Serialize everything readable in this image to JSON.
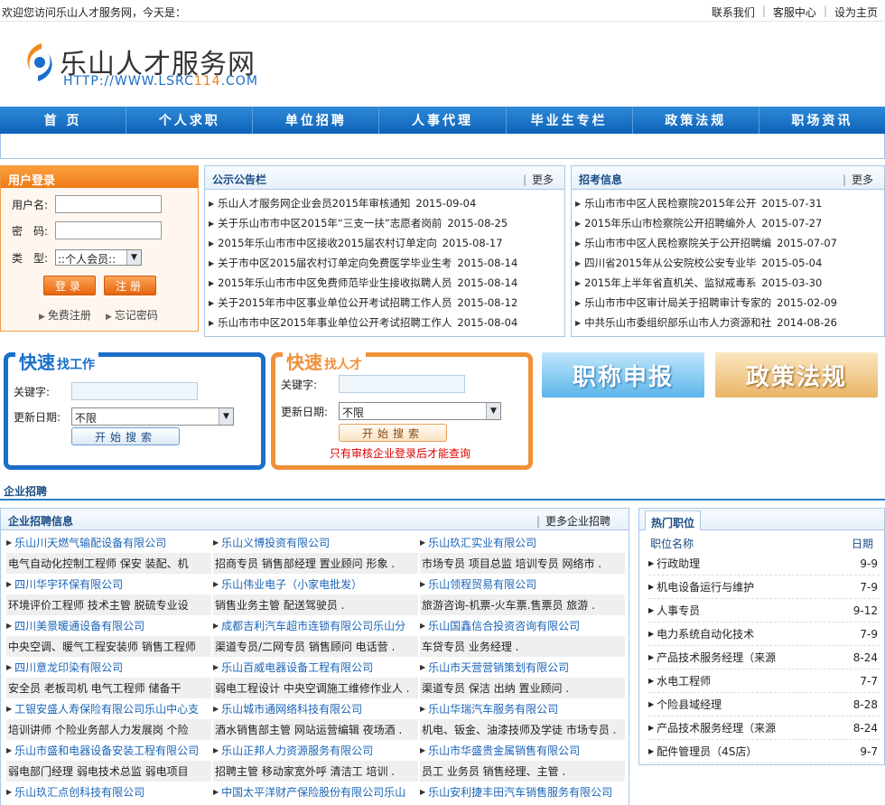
{
  "topbar": {
    "welcome": "欢迎您访问乐山人才服务网，今天是：",
    "links": [
      "联系我们",
      "客服中心",
      "设为主页"
    ]
  },
  "logo": {
    "name": "乐山人才服务网",
    "url_prefix": "HTTP://WWW.LSRC",
    "url_num": "114",
    "url_suffix": ".COM"
  },
  "nav": [
    "首 页",
    "个人求职",
    "单位招聘",
    "人事代理",
    "毕业生专栏",
    "政策法规",
    "职场资讯"
  ],
  "login": {
    "title": "用户登录",
    "username_label": "用户名:",
    "password_label": "密　码:",
    "type_label": "类　型:",
    "type_value": "::个人会员::",
    "login_btn": "登录",
    "register_btn": "注册",
    "free_register": "免费注册",
    "forgot_password": "忘记密码"
  },
  "notices": {
    "title": "公示公告栏",
    "more": "更多",
    "items": [
      {
        "title": "乐山人才服务网企业会员2015年审核通知",
        "date": "2015-09-04"
      },
      {
        "title": "关于乐山市市中区2015年“三支一扶”志愿者岗前",
        "date": "2015-08-25"
      },
      {
        "title": "2015年乐山市市中区接收2015届农村订单定向",
        "date": "2015-08-17"
      },
      {
        "title": "关于市中区2015届农村订单定向免费医学毕业生考",
        "date": "2015-08-14"
      },
      {
        "title": "2015年乐山市市中区免费师范毕业生接收拟聘人员",
        "date": "2015-08-14"
      },
      {
        "title": "关于2015年市中区事业单位公开考试招聘工作人员",
        "date": "2015-08-12"
      },
      {
        "title": "乐山市市中区2015年事业单位公开考试招聘工作人",
        "date": "2015-08-04"
      }
    ]
  },
  "recruit_info": {
    "title": "招考信息",
    "more": "更多",
    "items": [
      {
        "title": "乐山市市中区人民检察院2015年公开",
        "date": "2015-07-31"
      },
      {
        "title": "2015年乐山市检察院公开招聘编外人",
        "date": "2015-07-27"
      },
      {
        "title": "乐山市市中区人民检察院关于公开招聘编",
        "date": "2015-07-07"
      },
      {
        "title": "四川省2015年从公安院校公安专业毕",
        "date": "2015-05-04"
      },
      {
        "title": "2015年上半年省直机关、监狱戒毒系",
        "date": "2015-03-30"
      },
      {
        "title": "乐山市市中区审计局关于招聘审计专家的",
        "date": "2015-02-09"
      },
      {
        "title": "中共乐山市委组织部乐山市人力资源和社",
        "date": "2014-08-26"
      }
    ]
  },
  "quick_job": {
    "title_big": "快速",
    "title_small": "找工作",
    "keyword_label": "关键字:",
    "date_label": "更新日期:",
    "date_value": "不限",
    "search_btn": "开始搜索"
  },
  "quick_talent": {
    "title_big": "快速",
    "title_small": "找人才",
    "keyword_label": "关键字:",
    "date_label": "更新日期:",
    "date_value": "不限",
    "search_btn": "开始搜索",
    "note": "只有审核企业登录后才能查询"
  },
  "promos": [
    "职称申报",
    "政策法规"
  ],
  "section_title": "企业招聘",
  "companies": {
    "title": "企业招聘信息",
    "more": "更多企业招聘",
    "rows": [
      [
        {
          "name": "乐山川天燃气输配设备有限公司",
          "jobs": "电气自动化控制工程师 保安 装配、机"
        },
        {
          "name": "乐山义博投资有限公司",
          "jobs": "招商专员 销售部经理 置业顾问 形象 ."
        },
        {
          "name": "乐山玖汇实业有限公司",
          "jobs": "市场专员 项目总监 培训专员 网络市 ."
        }
      ],
      [
        {
          "name": "四川华宇环保有限公司",
          "jobs": "环境评价工程师 技术主管 脱硫专业设"
        },
        {
          "name": "乐山伟业电子（小家电批发）",
          "jobs": "销售业务主管 配送驾驶员 ."
        },
        {
          "name": "乐山领程贸易有限公司",
          "jobs": "旅游咨询-机票-火车票.售票员 旅游 ."
        }
      ],
      [
        {
          "name": "四川美景暖通设备有限公司",
          "jobs": "中央空调、暖气工程安装师 销售工程师"
        },
        {
          "name": "成都吉利汽车超市连锁有限公司乐山分",
          "jobs": "渠道专员/二网专员 销售顾问 电话营 ."
        },
        {
          "name": "乐山国鑫信合投资咨询有限公司",
          "jobs": "车贷专员 业务经理 ."
        }
      ],
      [
        {
          "name": "四川意龙印染有限公司",
          "jobs": "安全员 老板司机 电气工程师 储备干"
        },
        {
          "name": "乐山百威电器设备工程有限公司",
          "jobs": "弱电工程设计 中央空调施工维修作业人 ."
        },
        {
          "name": "乐山市天营营销策划有限公司",
          "jobs": "渠道专员 保洁 出纳 置业顾问 ."
        }
      ],
      [
        {
          "name": "工银安盛人寿保险有限公司乐山中心支",
          "jobs": "培训讲师 个险业务部人力发展岗 个险"
        },
        {
          "name": "乐山城市通网络科技有限公司",
          "jobs": "酒水销售部主管 网站运营编辑 夜场酒 ."
        },
        {
          "name": "乐山华瑞汽车服务有限公司",
          "jobs": "机电、钣金、油漆技师及学徒 市场专员 ."
        }
      ],
      [
        {
          "name": "乐山市盛和电器设备安装工程有限公司",
          "jobs": "弱电部门经理 弱电技术总监 弱电项目"
        },
        {
          "name": "乐山正邦人力资源服务有限公司",
          "jobs": "招聘主管 移动家宽外呼 清洁工 培训 ."
        },
        {
          "name": "乐山市华盛贵金属销售有限公司",
          "jobs": "员工 业务员 销售经理、主管 ."
        }
      ],
      [
        {
          "name": "乐山玖汇点创科技有限公司",
          "jobs": ""
        },
        {
          "name": "中国太平洋财产保险股份有限公司乐山",
          "jobs": ""
        },
        {
          "name": "乐山安利捷丰田汽车销售服务有限公司",
          "jobs": ""
        }
      ]
    ]
  },
  "hot_jobs": {
    "title": "热门职位",
    "col_name": "职位名称",
    "col_date": "日期",
    "items": [
      {
        "name": "行政助理",
        "date": "9-9"
      },
      {
        "name": "机电设备运行与维护",
        "date": "7-9"
      },
      {
        "name": "人事专员",
        "date": "9-12"
      },
      {
        "name": "电力系统自动化技术",
        "date": "7-9"
      },
      {
        "name": "产品技术服务经理（来源",
        "date": "8-24"
      },
      {
        "name": "水电工程师",
        "date": "7-7"
      },
      {
        "name": "个险县域经理",
        "date": "8-28"
      },
      {
        "name": "产品技术服务经理（来源",
        "date": "8-24"
      },
      {
        "name": "配件管理员（4S店）",
        "date": "9-7"
      }
    ]
  }
}
